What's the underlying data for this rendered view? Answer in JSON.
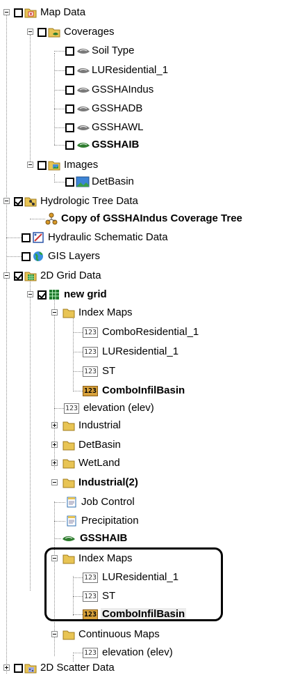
{
  "tree": {
    "map_data": "Map Data",
    "coverages": "Coverages",
    "cov_soil_type": "Soil Type",
    "cov_luresidential": "LUResidential_1",
    "cov_gsshaindus": "GSSHAIndus",
    "cov_gsshadb": "GSSHADB",
    "cov_gsshawl": "GSSHAWL",
    "cov_gsshaib": "GSSHAIB",
    "images": "Images",
    "img_detbasin": "DetBasin",
    "hydrologic_tree": "Hydrologic Tree Data",
    "copy_tree": "Copy of GSSHAIndus Coverage Tree",
    "hydraulic": "Hydraulic Schematic Data",
    "gis_layers": "GIS Layers",
    "grid_2d": "2D Grid Data",
    "new_grid": "new grid",
    "index_maps_1": "Index Maps",
    "im1_combo_res": "ComboResidential_1",
    "im1_lures": "LUResidential_1",
    "im1_st": "ST",
    "im1_combo_infil": "ComboInfilBasin",
    "elevation_1": "elevation (elev)",
    "industrial": "Industrial",
    "detbasin_folder": "DetBasin",
    "wetland": "WetLand",
    "industrial2": "Industrial(2)",
    "job_control": "Job Control",
    "precipitation": "Precipitation",
    "gsshaib_ref": "GSSHAIB",
    "index_maps_2": "Index Maps",
    "im2_lures": "LUResidential_1",
    "im2_st": "ST",
    "im2_combo_infil": "ComboInfilBasin",
    "continuous_maps": "Continuous Maps",
    "elevation_2": "elevation (elev)",
    "scatter_2d": "2D Scatter Data",
    "dataset_badge": "123"
  },
  "colors": {
    "folder": "#e8c454",
    "active_dataset": "#d8a23c",
    "tree_line": "#8c8c8c",
    "coverage_green": "#2f7d2f",
    "coverage_gray": "#7a7a7a"
  }
}
